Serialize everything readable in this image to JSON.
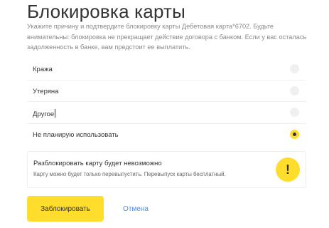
{
  "page": {
    "title": "Блокировка карты",
    "description": "Укажите причину и подтвердите блокировку карты Дебетовая карта*6702. Будьте внимательны: блокировка не прекращает действие договора с банком. Если у вас осталась задолженность в банке, вам предстоит ее выплатить."
  },
  "reasons": [
    {
      "label": "Кража",
      "selected": false
    },
    {
      "label": "Утеряна",
      "selected": false
    },
    {
      "label": "Другое",
      "selected": false
    },
    {
      "label": "Не планирую использовать",
      "selected": true
    }
  ],
  "notice": {
    "title": "Разблокировать карту будет невозможно",
    "text": "Карту можно будет только перевыпустить. Перевыпуск карты бесплатный.",
    "icon": "!"
  },
  "actions": {
    "block_label": "Заблокировать",
    "cancel_label": "Отмена"
  },
  "colors": {
    "accent": "#ffdd2d",
    "link": "#428bf9"
  }
}
